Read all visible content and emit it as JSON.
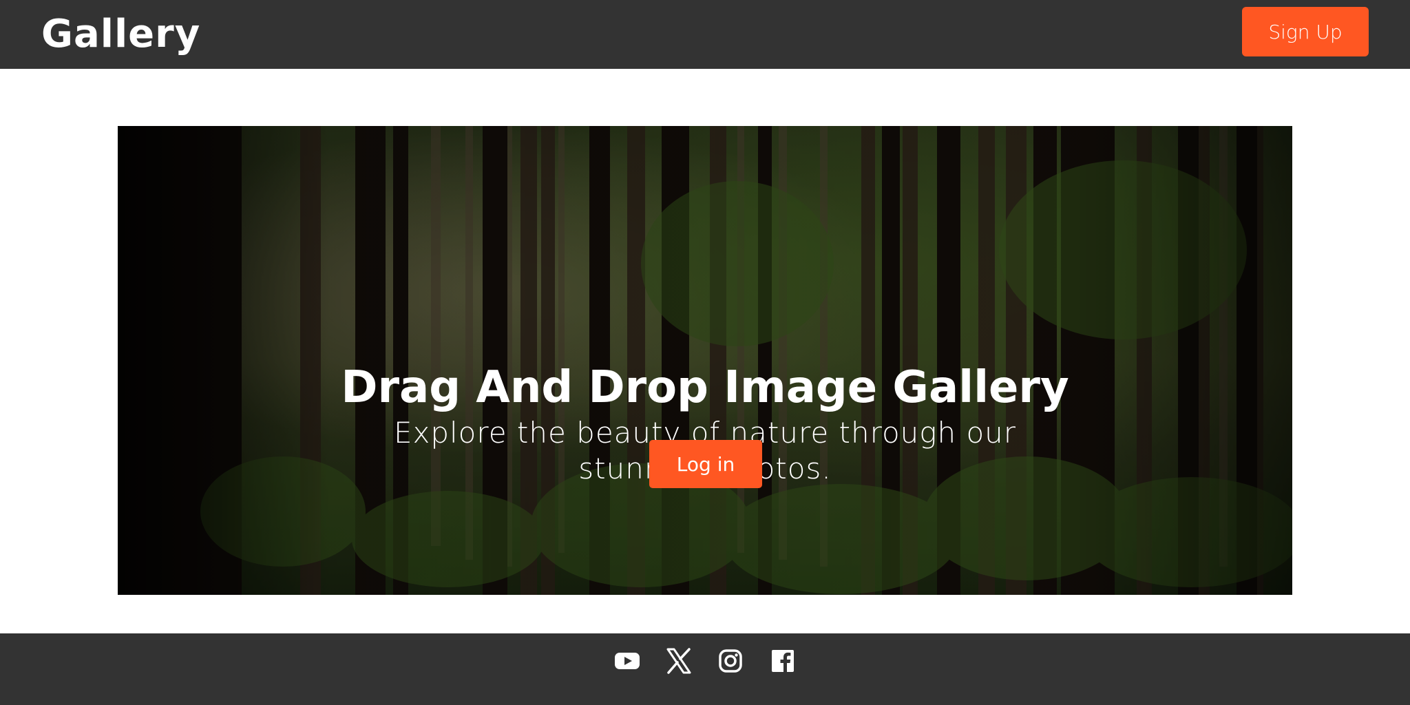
{
  "header": {
    "brand": "Gallery",
    "signup_label": "Sign Up"
  },
  "hero": {
    "title": "Drag And Drop Image Gallery",
    "subtitle": "Explore the beauty of nature through our stunning photos.",
    "login_label": "Log in",
    "image": "forest-photo"
  },
  "footer": {
    "social": [
      {
        "name": "youtube-icon"
      },
      {
        "name": "x-icon"
      },
      {
        "name": "instagram-icon"
      },
      {
        "name": "facebook-icon"
      }
    ]
  },
  "colors": {
    "header_bg": "#333333",
    "accent": "#ff5722",
    "footer_bg": "#333333",
    "text_light": "#ffffff"
  }
}
